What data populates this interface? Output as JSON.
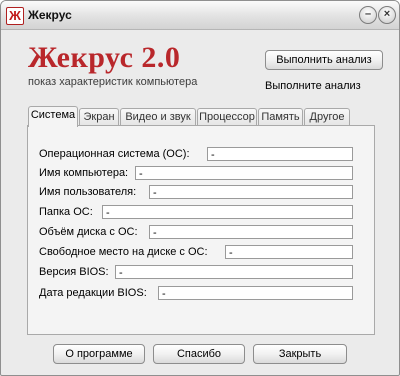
{
  "window": {
    "title": "Жекрус"
  },
  "header": {
    "brand": "Жекрус 2.0",
    "subtitle": "показ характеристик компьютера"
  },
  "actions": {
    "analyze_label": "Выполнить анализ",
    "status_text": "Выполните анализ"
  },
  "tabs": [
    {
      "label": "Система",
      "active": true
    },
    {
      "label": "Экран",
      "active": false
    },
    {
      "label": "Видео и звук",
      "active": false
    },
    {
      "label": "Процессор",
      "active": false
    },
    {
      "label": "Память",
      "active": false
    },
    {
      "label": "Другое",
      "active": false
    }
  ],
  "fields": [
    {
      "label": "Операционная система (ОС):",
      "value": "-"
    },
    {
      "label": "Имя компьютера:",
      "value": "-"
    },
    {
      "label": "Имя пользователя:",
      "value": "-"
    },
    {
      "label": "Папка ОС:",
      "value": "-"
    },
    {
      "label": "Объём диска с ОС:",
      "value": "-"
    },
    {
      "label": "Свободное место на диске с ОС:",
      "value": "-"
    },
    {
      "label": "Версия BIOS:",
      "value": "-"
    },
    {
      "label": "Дата редакции BIOS:",
      "value": "-"
    }
  ],
  "footer": {
    "about_label": "О программе",
    "thanks_label": "Спасибо",
    "close_label": "Закрыть"
  },
  "colors": {
    "brand": "#b9272b",
    "window_bg": "#ebebeb",
    "panel_bg": "#f4f4f4"
  }
}
